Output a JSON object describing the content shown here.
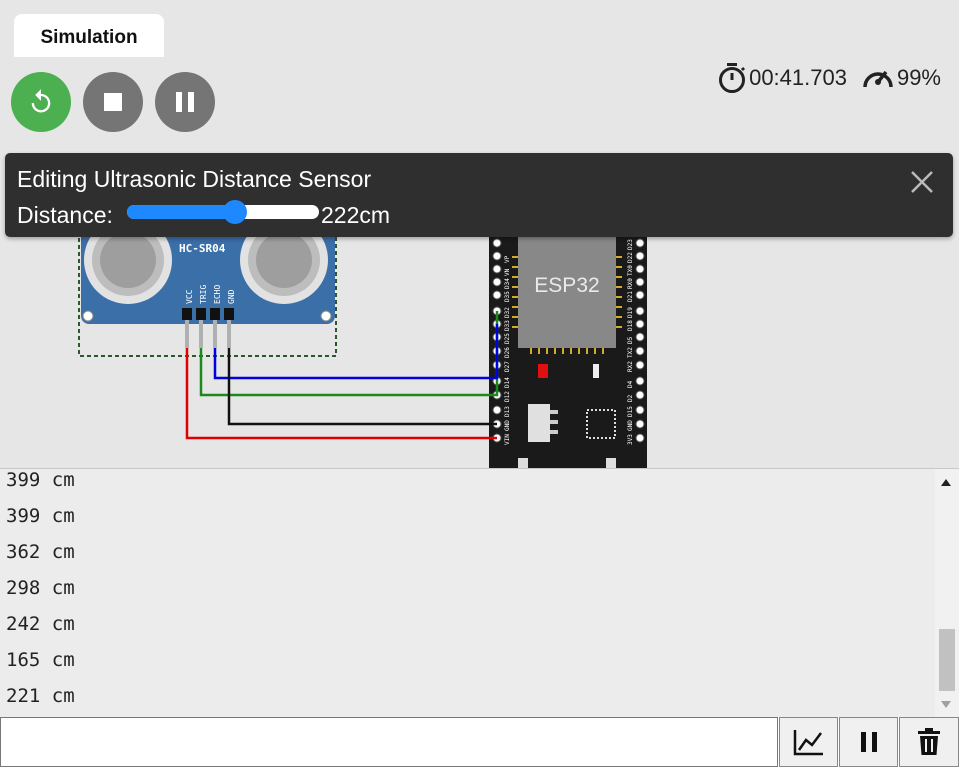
{
  "tab": {
    "label": "Simulation"
  },
  "status": {
    "timer": "00:41.703",
    "speed": "99%"
  },
  "editor": {
    "title": "Editing Ultrasonic Distance Sensor",
    "distance_label": "Distance:",
    "distance_value": "222cm",
    "slider_fraction": 0.56
  },
  "sensor": {
    "model": "HC-SR04",
    "pins": [
      "VCC",
      "TRIG",
      "ECHO",
      "GND"
    ]
  },
  "board": {
    "label": "ESP32",
    "left_pins": [
      "VP",
      "VN",
      "D34",
      "D35",
      "D32",
      "D33",
      "D25",
      "D26",
      "D27",
      "D14",
      "D12",
      "D13",
      "GND",
      "VIN"
    ],
    "right_pins": [
      "D23",
      "D22",
      "TX0",
      "RX0",
      "D21",
      "D19",
      "D18",
      "D5",
      "TX2",
      "RX2",
      "D4",
      "D2",
      "D15",
      "GND",
      "3V3"
    ]
  },
  "serial_lines": [
    "399 cm",
    "399 cm",
    "362 cm",
    "298 cm",
    "242 cm",
    "165 cm",
    "221 cm"
  ],
  "colors": {
    "accent": "#4caf50",
    "slider": "#1e88ff",
    "wire_vcc": "#e00000",
    "wire_trig": "#1a8a1a",
    "wire_echo": "#0000e0",
    "wire_gnd": "#111111"
  },
  "icons": [
    "restart-icon",
    "stop-icon",
    "pause-icon",
    "stopwatch-icon",
    "speedometer-icon",
    "close-icon",
    "chart-icon",
    "pause-icon",
    "trash-icon"
  ]
}
